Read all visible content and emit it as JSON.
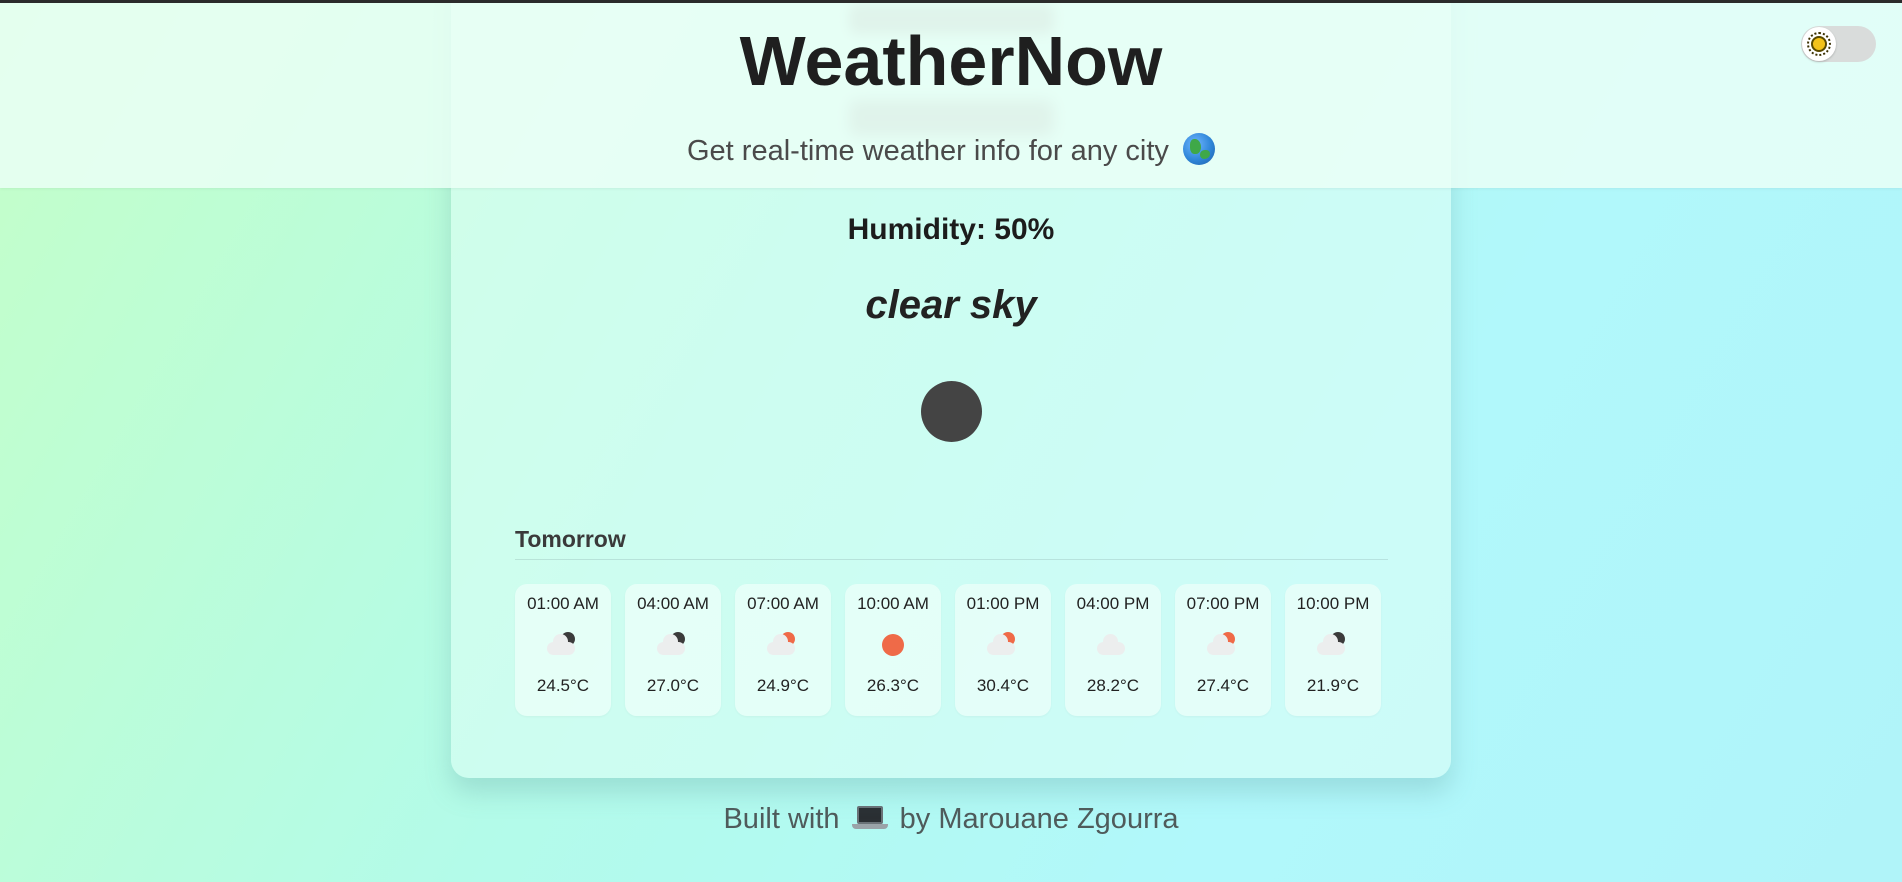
{
  "header": {
    "app_title": "WeatherNow",
    "subtitle": "Get real-time weather info for any city",
    "subtitle_icon": "globe-icon",
    "theme_toggle_icon": "sun-icon"
  },
  "current": {
    "humidity": "Humidity: 50%",
    "description": "clear sky",
    "icon": "clear-night-icon"
  },
  "forecast": {
    "section_title": "Tomorrow",
    "hours": [
      {
        "time": "01:00 AM",
        "temp": "24.5°C",
        "icon": "partly-cloudy-night-icon"
      },
      {
        "time": "04:00 AM",
        "temp": "27.0°C",
        "icon": "partly-cloudy-night-icon"
      },
      {
        "time": "07:00 AM",
        "temp": "24.9°C",
        "icon": "partly-cloudy-day-icon"
      },
      {
        "time": "10:00 AM",
        "temp": "26.3°C",
        "icon": "clear-day-icon"
      },
      {
        "time": "01:00 PM",
        "temp": "30.4°C",
        "icon": "partly-cloudy-day-icon"
      },
      {
        "time": "04:00 PM",
        "temp": "28.2°C",
        "icon": "cloudy-icon"
      },
      {
        "time": "07:00 PM",
        "temp": "27.4°C",
        "icon": "partly-cloudy-day-icon"
      },
      {
        "time": "10:00 PM",
        "temp": "21.9°C",
        "icon": "partly-cloudy-night-icon"
      }
    ]
  },
  "footer": {
    "prefix": "Built with",
    "icon": "laptop-icon",
    "suffix": "by Marouane Zgourra"
  },
  "colors": {
    "background_start": "#c4ffc8",
    "background_end": "#b0f4f9",
    "sun_orange": "#ef6a48",
    "night_dark": "#3b3b3b",
    "cloud_light": "#eceeee"
  }
}
